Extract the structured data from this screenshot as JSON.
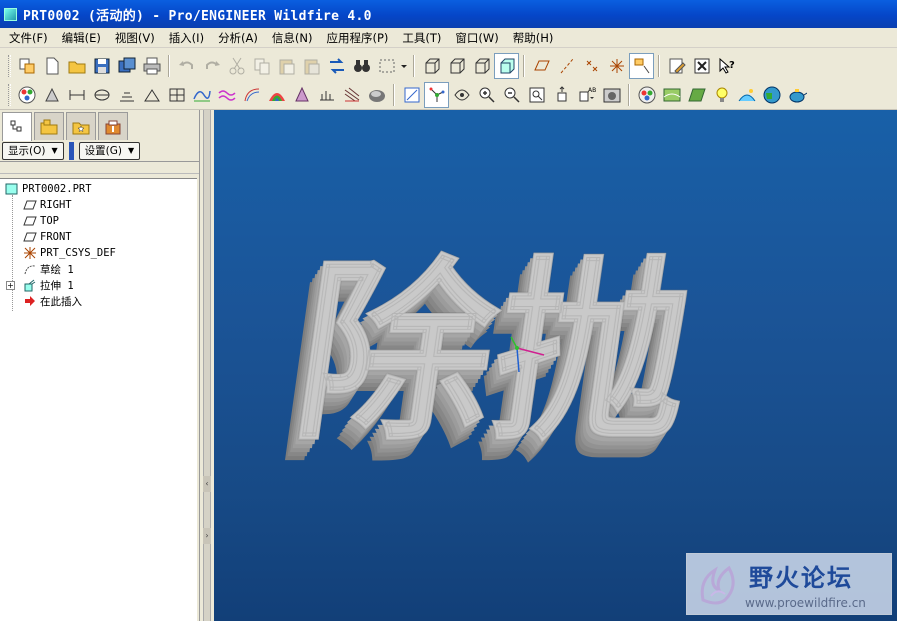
{
  "window": {
    "title": "PRT0002 (活动的) - Pro/ENGINEER Wildfire 4.0"
  },
  "menu": [
    "文件(F)",
    "编辑(E)",
    "视图(V)",
    "插入(I)",
    "分析(A)",
    "信息(N)",
    "应用程序(P)",
    "工具(T)",
    "窗口(W)",
    "帮助(H)"
  ],
  "panel": {
    "show_label": "显示(O)",
    "settings_label": "设置(G)",
    "tree": [
      {
        "label": "PRT0002.PRT",
        "icon": "part-icon"
      },
      {
        "label": "RIGHT",
        "icon": "datum-plane-icon"
      },
      {
        "label": "TOP",
        "icon": "datum-plane-icon"
      },
      {
        "label": "FRONT",
        "icon": "datum-plane-icon"
      },
      {
        "label": "PRT_CSYS_DEF",
        "icon": "csys-icon"
      },
      {
        "label": "草绘 1",
        "icon": "sketch-icon"
      },
      {
        "label": "拉伸 1",
        "icon": "extrude-icon"
      },
      {
        "label": "在此插入",
        "icon": "insert-arrow-icon"
      }
    ]
  },
  "model": {
    "text": "除抛"
  },
  "watermark": {
    "title": "野火论坛",
    "url": "www.proewildfire.cn"
  },
  "colors": {
    "titlebar": "#0546c8",
    "viewport_top": "#1860a8",
    "viewport_bottom": "#123f78",
    "model_face": "#c8c8c8",
    "model_side": "#8e8e8e"
  }
}
